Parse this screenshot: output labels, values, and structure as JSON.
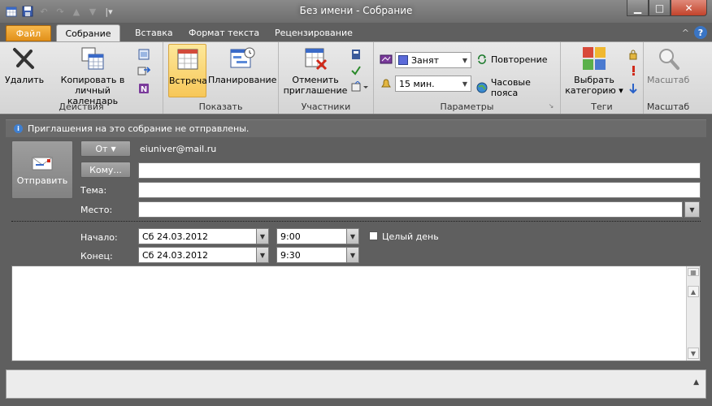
{
  "window": {
    "title": "Без имени  -  Собрание",
    "min": "▁",
    "max": "□",
    "close": "✕"
  },
  "qat": {
    "undo": "↶",
    "redo": "↷",
    "up": "▲",
    "down": "▼",
    "more": "|▾"
  },
  "tabs": {
    "file": "Файл",
    "items": [
      {
        "label": "Собрание"
      },
      {
        "label": "Вставка"
      },
      {
        "label": "Формат текста"
      },
      {
        "label": "Рецензирование"
      }
    ],
    "help": "?",
    "collapse": "^"
  },
  "ribbon": {
    "actions": {
      "label": "Действия",
      "delete": "Удалить",
      "copy_line1": "Копировать в",
      "copy_line2": "личный календарь"
    },
    "show": {
      "label": "Показать",
      "meeting": "Встреча",
      "scheduling": "Планирование"
    },
    "attendees": {
      "label": "Участники",
      "cancel_line1": "Отменить",
      "cancel_line2": "приглашение"
    },
    "options": {
      "label": "Параметры",
      "show_as": "Занят",
      "reminder": "15 мин.",
      "recurrence": "Повторение",
      "timezones": "Часовые пояса"
    },
    "tags": {
      "label": "Теги",
      "category_line1": "Выбрать",
      "category_line2": "категорию ▾"
    },
    "zoom": {
      "label": "Масштаб",
      "zoom": "Масштаб"
    }
  },
  "infobar": {
    "text": "Приглашения на это собрание не отправлены."
  },
  "form": {
    "send": "Отправить",
    "from_button": "От",
    "from_address": "eiuniver@mail.ru",
    "to_button": "Кому...",
    "to_value": "",
    "subject_label": "Тема:",
    "subject_value": "",
    "location_label": "Место:",
    "location_value": "",
    "start_label": "Начало:",
    "start_date": "Сб 24.03.2012",
    "start_time": "9:00",
    "allday_label": "Целый день",
    "end_label": "Конец:",
    "end_date": "Сб 24.03.2012",
    "end_time": "9:30"
  },
  "colors": {
    "file_tab": "#e1901a",
    "active_button": "#f7c758",
    "busy_swatch": "#5b6ad9",
    "background": "#5f5f5f"
  }
}
